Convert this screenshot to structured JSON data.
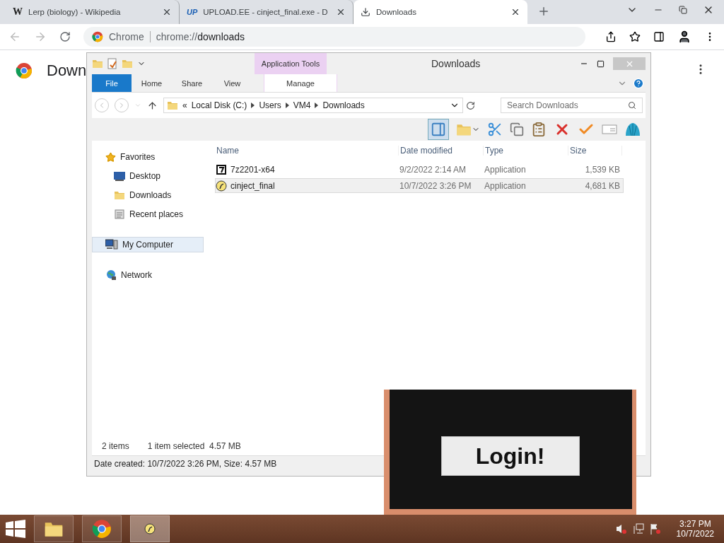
{
  "browser": {
    "tabs": [
      {
        "favicon": "W",
        "title": "Lerp (biology) - Wikipedia",
        "selected": false
      },
      {
        "favicon": "UP",
        "title": "UPLOAD.EE - cinject_final.exe - D",
        "selected": false
      },
      {
        "title": "Downloads",
        "selected": true
      }
    ],
    "address": {
      "label": "Chrome",
      "url_scheme": "chrome://",
      "url_path": "downloads"
    }
  },
  "page": {
    "heading": "Down"
  },
  "explorer": {
    "title": "Downloads",
    "context_tab": "Application Tools",
    "ribbon_tabs": [
      {
        "label": "File",
        "kind": "file"
      },
      {
        "label": "Home",
        "kind": "plain"
      },
      {
        "label": "Share",
        "kind": "plain"
      },
      {
        "label": "View",
        "kind": "plain"
      },
      {
        "label": "Manage",
        "kind": "context"
      }
    ],
    "breadcrumb": {
      "prefix": "«",
      "parts": [
        "Local Disk (C:)",
        "Users",
        "VM4",
        "Downloads"
      ]
    },
    "search": {
      "placeholder": "Search Downloads"
    },
    "nav": [
      {
        "label": "Favorites",
        "kind": "favorites",
        "selected": false,
        "children": [
          {
            "label": "Desktop",
            "kind": "desktop",
            "selected": false
          },
          {
            "label": "Downloads",
            "kind": "downloads",
            "selected": false
          },
          {
            "label": "Recent places",
            "kind": "recent",
            "selected": false
          }
        ]
      },
      {
        "label": "My Computer",
        "kind": "computer",
        "selected": true
      },
      {
        "label": "Network",
        "kind": "network",
        "selected": false
      }
    ],
    "columns": [
      "Name",
      "Date modified",
      "Type",
      "Size"
    ],
    "rows": [
      {
        "name": "7z2201-x64",
        "kind": "archiver",
        "date": "9/2/2022 2:14 AM",
        "type": "Application",
        "size": "1,539 KB",
        "selected": false
      },
      {
        "name": "cinject_final",
        "kind": "app",
        "date": "10/7/2022 3:26 PM",
        "type": "Application",
        "size": "4,681 KB",
        "selected": true
      }
    ],
    "status": {
      "count": "2 items",
      "selection": "1 item selected  4.57 MB"
    },
    "details": "Date created: 10/7/2022 3:26 PM, Size: 4.57 MB"
  },
  "popup": {
    "button": "Login!"
  },
  "taskbar": {
    "time": "3:27 PM",
    "date": "10/7/2022"
  }
}
